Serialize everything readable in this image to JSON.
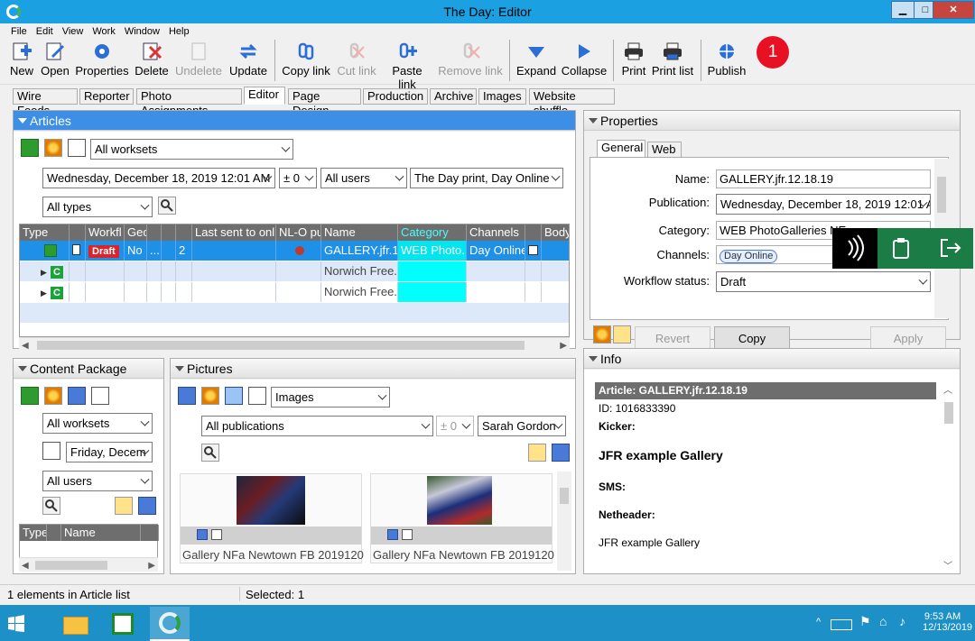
{
  "window": {
    "title": "The Day: Editor",
    "minimize": "▁",
    "maximize": "□",
    "close": "✕"
  },
  "menu": [
    "File",
    "Edit",
    "View",
    "Work",
    "Window",
    "Help"
  ],
  "toolbar": {
    "new": "New",
    "open": "Open",
    "properties": "Properties",
    "delete": "Delete",
    "undelete": "Undelete",
    "update": "Update",
    "copy_link": "Copy link",
    "cut_link": "Cut link",
    "paste_link": "Paste link",
    "remove_link": "Remove link",
    "expand": "Expand",
    "collapse": "Collapse",
    "print": "Print",
    "print_list": "Print list",
    "publish": "Publish",
    "notification_count": "1"
  },
  "tabs": [
    "Wire Feeds",
    "Reporter",
    "Photo Assignments",
    "Editor",
    "Page Design",
    "Production",
    "Archive",
    "Images",
    "Website shuffle"
  ],
  "articles": {
    "title": "Articles",
    "worksets": "All worksets",
    "date": "Wednesday, December 18, 2019 12:01 AM",
    "offset": "± 0",
    "users": "All users",
    "publication": "The Day print, Day Online",
    "types": "All types",
    "columns": [
      "Type",
      "",
      "Workfl",
      "Geo",
      "",
      "",
      "",
      "Last sent to onli",
      "NL-O pu",
      "Name",
      "Category",
      "Channels",
      "",
      "Body"
    ],
    "rows": [
      {
        "workflow": "Draft",
        "geo": "No",
        "geo2": "...",
        "count": "2",
        "name": "GALLERY.jfr.1...",
        "category": "WEB Photo...",
        "channels": "Day Online"
      },
      {
        "name": "Norwich Free..."
      },
      {
        "name": "Norwich Free..."
      }
    ]
  },
  "properties": {
    "title": "Properties",
    "tabs": [
      "General",
      "Web"
    ],
    "name_label": "Name:",
    "name_value": "GALLERY.jfr.12.18.19",
    "publication_label": "Publication:",
    "publication_value": "Wednesday, December 18, 2019 12:01 A",
    "category_label": "Category:",
    "category_value": "WEB PhotoGalleries NE",
    "channels_label": "Channels:",
    "channels_value": "Day Online",
    "workflow_label": "Workflow status:",
    "workflow_value": "Draft",
    "revert": "Revert",
    "copy": "Copy",
    "apply": "Apply"
  },
  "info": {
    "title": "Info",
    "article": "Article: GALLERY.jfr.12.18.19",
    "id": "ID: 1016833390",
    "kicker": "Kicker:",
    "headline": "JFR example Gallery",
    "sms": "SMS:",
    "netheader": "Netheader:",
    "body": "JFR example Gallery"
  },
  "content_package": {
    "title": "Content Package",
    "worksets": "All worksets",
    "date": "Friday, Decem",
    "users": "All users",
    "columns": [
      "Type",
      "",
      "Name",
      ""
    ]
  },
  "pictures": {
    "title": "Pictures",
    "source": "Images",
    "publication": "All publications",
    "offset": "± 0",
    "user": "Sarah Gordon",
    "items": [
      {
        "caption": "Gallery NFa Newtown FB 2019120"
      },
      {
        "caption": "Gallery NFa Newtown FB 2019120"
      }
    ]
  },
  "status": {
    "left": "1 elements in Article list",
    "right": "Selected: 1"
  },
  "taskbar": {
    "time": "9:53 AM",
    "date": "12/13/2019"
  }
}
